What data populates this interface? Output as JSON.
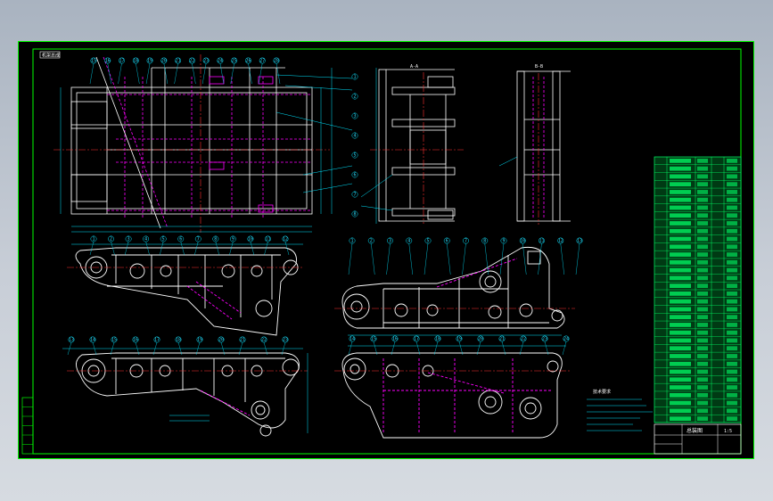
{
  "drawing": {
    "colors": {
      "background": "#000000",
      "frame": "#00ff00",
      "outline": "#ffffff",
      "leader": "#00e5ff",
      "hidden": "#ff00ff",
      "centerline": "#ff3030",
      "table_fill": "#00ff66"
    },
    "title_block": {
      "name": "总装图",
      "scale": "1:5"
    },
    "tag": "机架总成",
    "section_labels": [
      "A-A",
      "B-B"
    ],
    "notes_title": "技术要求",
    "balloons": {
      "plan": [
        "15",
        "16",
        "17",
        "18",
        "19",
        "20",
        "21",
        "22",
        "23",
        "24",
        "25",
        "26",
        "27",
        "28"
      ],
      "plan_right": [
        "1",
        "2",
        "3",
        "4",
        "5",
        "6",
        "7",
        "8"
      ],
      "side1": [
        "1",
        "2",
        "3",
        "4",
        "5",
        "6",
        "7",
        "8",
        "9",
        "10",
        "11",
        "12"
      ],
      "side2": [
        "13",
        "14",
        "15",
        "16",
        "17",
        "18",
        "19",
        "20",
        "21",
        "22",
        "23"
      ],
      "side3": [
        "1",
        "2",
        "3",
        "4",
        "5",
        "6",
        "7",
        "8",
        "9",
        "10",
        "11",
        "12",
        "13"
      ],
      "side4": [
        "14",
        "15",
        "16",
        "17",
        "18",
        "19",
        "20",
        "21",
        "22",
        "23",
        "24"
      ]
    },
    "bom_rows": 34,
    "revision_cells": 6
  }
}
